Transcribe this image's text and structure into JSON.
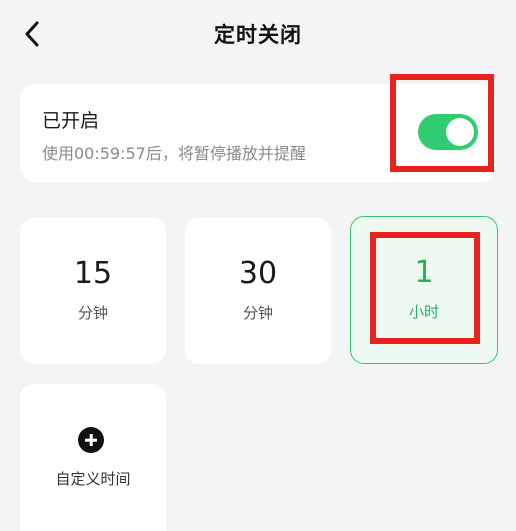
{
  "header": {
    "title": "定时关闭",
    "back_icon": "chevron-left-icon"
  },
  "status": {
    "title": "已开启",
    "description": "使用00:59:57后，将暂停播放并提醒",
    "toggle_on": true,
    "toggle_color": "#2fcc71"
  },
  "options": [
    {
      "number": "15",
      "unit": "分钟",
      "selected": false
    },
    {
      "number": "30",
      "unit": "分钟",
      "selected": false
    },
    {
      "number": "1",
      "unit": "小时",
      "selected": true
    }
  ],
  "custom": {
    "label": "自定义时间",
    "icon": "plus-circle-icon"
  },
  "colors": {
    "accent": "#27ae60",
    "highlight": "#e8231f",
    "background": "#f3f4f6"
  }
}
